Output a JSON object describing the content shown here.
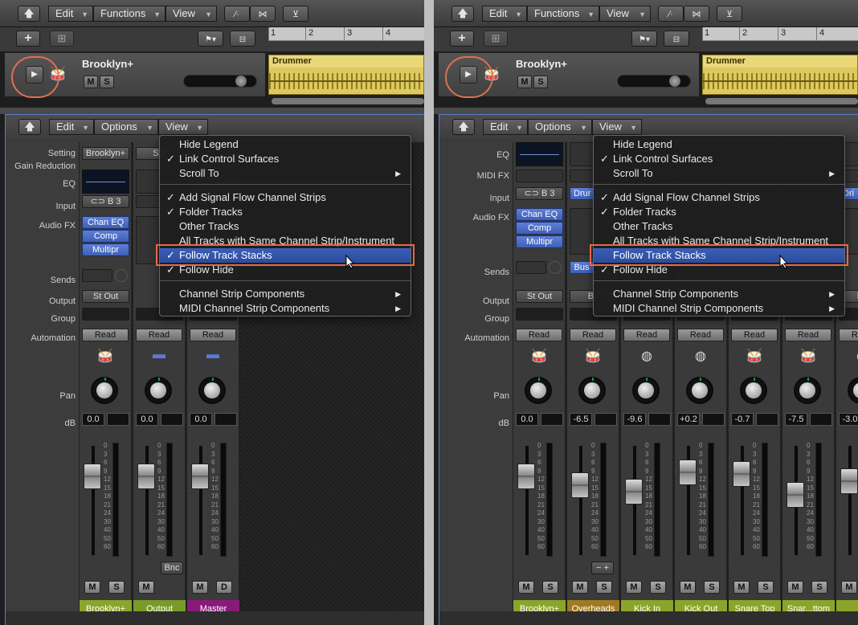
{
  "accent_blue": "#3a5fb8",
  "highlight_color": "#e46a4a",
  "panels": [
    {
      "toolbar": {
        "edit": "Edit",
        "functions": "Functions",
        "view": "View"
      },
      "ruler": [
        "1",
        "2",
        "3",
        "4"
      ],
      "track": {
        "name": "Brooklyn+",
        "mute": "M",
        "solo": "S",
        "region_name": "Drummer"
      },
      "mixer_menu": {
        "edit": "Edit",
        "options": "Options",
        "view": "View"
      },
      "labels": {
        "setting": "Setting",
        "gain_reduction": "Gain Reduction",
        "eq": "EQ",
        "input": "Input",
        "audio_fx": "Audio FX",
        "sends": "Sends",
        "output": "Output",
        "group": "Group",
        "automation": "Automation",
        "pan": "Pan",
        "db": "dB"
      },
      "strips": [
        {
          "setting": "Brooklyn+",
          "input": "B 3",
          "fx": [
            "Chan EQ",
            "Comp",
            "Multipr"
          ],
          "output": "St Out",
          "read": "Read",
          "db": "0.0",
          "m": "M",
          "s": "S",
          "name": "Brooklyn+",
          "name_color": "#8ba52a"
        },
        {
          "setting": "Set",
          "read": "Read",
          "db": "0.0",
          "m": "M",
          "bnc": "Bnc",
          "name": "Output",
          "name_color": "#7a9a2a"
        },
        {
          "read": "Read",
          "db": "0.0",
          "m": "M",
          "d": "D",
          "name": "Master",
          "name_color": "#8a1a7a"
        }
      ],
      "scale": [
        "0",
        "3",
        "6",
        "9",
        "12",
        "15",
        "18",
        "21",
        "24",
        "30",
        "40",
        "50",
        "60"
      ],
      "menu": {
        "items": [
          {
            "label": "Hide Legend",
            "check": ""
          },
          {
            "label": "Link Control Surfaces",
            "check": "✓"
          },
          {
            "label": "Scroll To",
            "check": "",
            "sub": "▶"
          },
          {
            "label": "Add Signal Flow Channel Strips",
            "check": "✓"
          },
          {
            "label": "Folder Tracks",
            "check": "✓"
          },
          {
            "label": "Other Tracks",
            "check": ""
          },
          {
            "label": "All Tracks with Same Channel Strip/Instrument",
            "check": ""
          },
          {
            "label": "Follow Track Stacks",
            "check": "✓"
          },
          {
            "label": "Follow Hide",
            "check": "✓"
          },
          {
            "label": "Channel Strip Components",
            "check": "",
            "sub": "▶"
          },
          {
            "label": "MIDI Channel Strip Components",
            "check": "",
            "sub": "▶"
          }
        ]
      }
    },
    {
      "toolbar": {
        "edit": "Edit",
        "functions": "Functions",
        "view": "View"
      },
      "ruler": [
        "1",
        "2",
        "3",
        "4"
      ],
      "track": {
        "name": "Brooklyn+",
        "mute": "M",
        "solo": "S",
        "region_name": "Drummer"
      },
      "mixer_menu": {
        "edit": "Edit",
        "options": "Options",
        "view": "View"
      },
      "labels": {
        "eq": "EQ",
        "midi_fx": "MIDI FX",
        "input": "Input",
        "audio_fx": "Audio FX",
        "sends": "Sends",
        "output": "Output",
        "group": "Group",
        "automation": "Automation",
        "pan": "Pan",
        "db": "dB"
      },
      "strips": [
        {
          "input": "B 3",
          "fx": [
            "Chan EQ",
            "Comp",
            "Multipr"
          ],
          "output": "St Out",
          "read": "Read",
          "db": "0.0",
          "m": "M",
          "s": "S",
          "name": "Brooklyn+",
          "name_color": "#8ba52a"
        },
        {
          "input": "Drur",
          "send": "Bus",
          "output": "Bu",
          "read": "Read",
          "db": "-6.5",
          "m": "M",
          "s": "S",
          "name": "Overheads",
          "name_color": "#a07a20",
          "stepper": "− +"
        },
        {
          "read": "Read",
          "db": "-9.6",
          "m": "M",
          "s": "S",
          "name": "Kick In",
          "name_color": "#8ba52a"
        },
        {
          "read": "Read",
          "db": "+0.2",
          "m": "M",
          "s": "S",
          "name": "Kick Out",
          "name_color": "#8ba52a"
        },
        {
          "read": "Read",
          "db": "-0.7",
          "m": "M",
          "s": "S",
          "name": "Snare Top",
          "name_color": "#8ba52a"
        },
        {
          "read": "Read",
          "db": "-7.5",
          "m": "M",
          "s": "S",
          "name": "Snar...ttom",
          "name_color": "#8ba52a"
        },
        {
          "input": "Dri",
          "output": "Bu",
          "read": "Read",
          "db": "-3.0",
          "m": "M",
          "name": "Hi",
          "name_color": "#8ba52a"
        }
      ],
      "scale": [
        "0",
        "3",
        "6",
        "9",
        "12",
        "15",
        "18",
        "21",
        "24",
        "30",
        "40",
        "50",
        "60"
      ],
      "fader_levels": [
        0.72,
        0.64,
        0.58,
        0.76,
        0.74,
        0.55,
        0.68
      ],
      "menu": {
        "items": [
          {
            "label": "Hide Legend",
            "check": ""
          },
          {
            "label": "Link Control Surfaces",
            "check": "✓"
          },
          {
            "label": "Scroll To",
            "check": "",
            "sub": "▶"
          },
          {
            "label": "Add Signal Flow Channel Strips",
            "check": "✓"
          },
          {
            "label": "Folder Tracks",
            "check": "✓"
          },
          {
            "label": "Other Tracks",
            "check": ""
          },
          {
            "label": "All Tracks with Same Channel Strip/Instrument",
            "check": ""
          },
          {
            "label": "Follow Track Stacks",
            "check": ""
          },
          {
            "label": "Follow Hide",
            "check": "✓"
          },
          {
            "label": "Channel Strip Components",
            "check": "",
            "sub": "▶"
          },
          {
            "label": "MIDI Channel Strip Components",
            "check": "",
            "sub": "▶"
          }
        ]
      }
    }
  ]
}
